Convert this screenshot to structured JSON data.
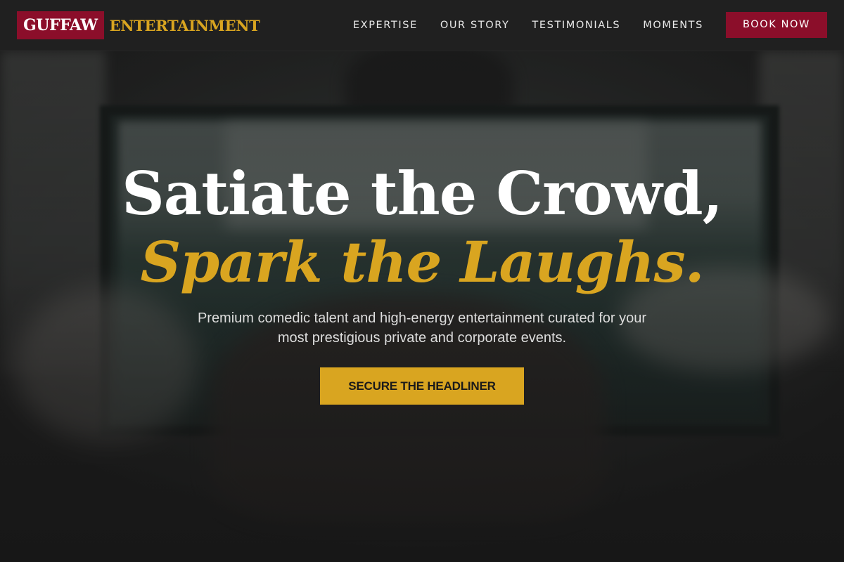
{
  "brand": {
    "mark": "GUFFAW",
    "name": "ENTERTAINMENT",
    "colors": {
      "primary": "#8b0e2a",
      "accent": "#d9a520",
      "header_bg": "#202020"
    }
  },
  "nav": {
    "links": [
      {
        "label": "EXPERTISE"
      },
      {
        "label": "OUR STORY"
      },
      {
        "label": "TESTIMONIALS"
      },
      {
        "label": "MOMENTS"
      }
    ],
    "cta_label": "BOOK NOW"
  },
  "hero": {
    "headline_line1": "Satiate the Crowd,",
    "headline_line2": "Spark the Laughs.",
    "subtitle": "Premium comedic talent and high-energy entertainment curated for your most prestigious private and corporate events.",
    "cta_label": "SECURE THE HEADLINER"
  }
}
